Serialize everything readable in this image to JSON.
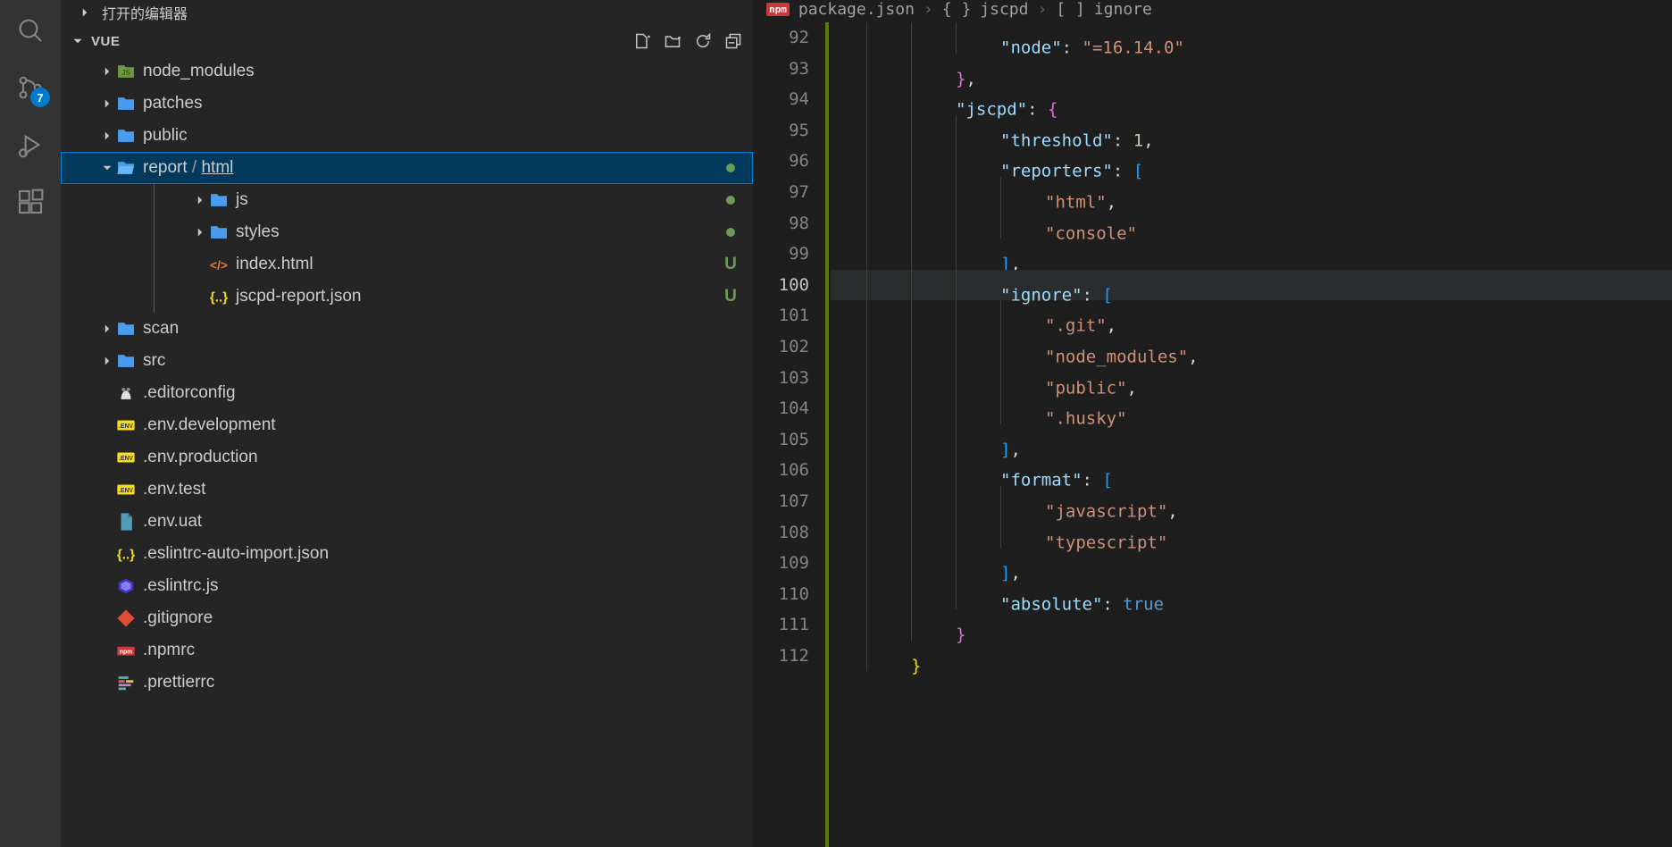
{
  "activity": {
    "badge": "7"
  },
  "sidebar": {
    "openEditors": "打开的编辑器",
    "project": "VUE",
    "tree": [
      {
        "type": "folder",
        "name": "node_modules",
        "depth": 1,
        "expanded": false,
        "icon": "node",
        "dim": true
      },
      {
        "type": "folder",
        "name": "patches",
        "depth": 1,
        "expanded": false,
        "icon": "folder"
      },
      {
        "type": "folder",
        "name": "public",
        "depth": 1,
        "expanded": false,
        "icon": "folder"
      },
      {
        "type": "folder",
        "name": "report",
        "suffix": "html",
        "depth": 1,
        "expanded": true,
        "icon": "folder-open",
        "selected": true,
        "status": "dot"
      },
      {
        "type": "folder",
        "name": "js",
        "depth": 2,
        "expanded": false,
        "icon": "folder",
        "status": "dot",
        "green": true
      },
      {
        "type": "folder",
        "name": "styles",
        "depth": 2,
        "expanded": false,
        "icon": "folder",
        "status": "dot",
        "green": true
      },
      {
        "type": "file",
        "name": "index.html",
        "depth": 2,
        "icon": "html",
        "status": "U",
        "green": true
      },
      {
        "type": "file",
        "name": "jscpd-report.json",
        "depth": 2,
        "icon": "json",
        "status": "U",
        "green": true
      },
      {
        "type": "folder",
        "name": "scan",
        "depth": 1,
        "expanded": false,
        "icon": "folder"
      },
      {
        "type": "folder",
        "name": "src",
        "depth": 1,
        "expanded": false,
        "icon": "folder"
      },
      {
        "type": "file",
        "name": ".editorconfig",
        "depth": 1,
        "icon": "editorconfig"
      },
      {
        "type": "file",
        "name": ".env.development",
        "depth": 1,
        "icon": "env"
      },
      {
        "type": "file",
        "name": ".env.production",
        "depth": 1,
        "icon": "env"
      },
      {
        "type": "file",
        "name": ".env.test",
        "depth": 1,
        "icon": "env"
      },
      {
        "type": "file",
        "name": ".env.uat",
        "depth": 1,
        "icon": "file"
      },
      {
        "type": "file",
        "name": ".eslintrc-auto-import.json",
        "depth": 1,
        "icon": "json"
      },
      {
        "type": "file",
        "name": ".eslintrc.js",
        "depth": 1,
        "icon": "eslint"
      },
      {
        "type": "file",
        "name": ".gitignore",
        "depth": 1,
        "icon": "git"
      },
      {
        "type": "file",
        "name": ".npmrc",
        "depth": 1,
        "icon": "npm"
      },
      {
        "type": "file",
        "name": ".prettierrc",
        "depth": 1,
        "icon": "prettier"
      }
    ]
  },
  "editor": {
    "breadcrumb": [
      "package.json",
      "jscpd",
      "ignore"
    ],
    "startLine": 92,
    "activeLine": 100,
    "lines": [
      [
        {
          "t": "ind",
          "v": "            "
        },
        {
          "t": "key",
          "v": "\"node\""
        },
        {
          "t": "punct",
          "v": ": "
        },
        {
          "t": "str",
          "v": "\"=16.14.0\""
        }
      ],
      [
        {
          "t": "ind",
          "v": "        "
        },
        {
          "t": "brace-p",
          "v": "}"
        },
        {
          "t": "punct",
          "v": ","
        }
      ],
      [
        {
          "t": "ind",
          "v": "        "
        },
        {
          "t": "key",
          "v": "\"jscpd\""
        },
        {
          "t": "punct",
          "v": ": "
        },
        {
          "t": "brace-p",
          "v": "{"
        }
      ],
      [
        {
          "t": "ind",
          "v": "            "
        },
        {
          "t": "key",
          "v": "\"threshold\""
        },
        {
          "t": "punct",
          "v": ": "
        },
        {
          "t": "num",
          "v": "1"
        },
        {
          "t": "punct",
          "v": ","
        }
      ],
      [
        {
          "t": "ind",
          "v": "            "
        },
        {
          "t": "key",
          "v": "\"reporters\""
        },
        {
          "t": "punct",
          "v": ": "
        },
        {
          "t": "brace-b",
          "v": "["
        }
      ],
      [
        {
          "t": "ind",
          "v": "                "
        },
        {
          "t": "str",
          "v": "\"html\""
        },
        {
          "t": "punct",
          "v": ","
        }
      ],
      [
        {
          "t": "ind",
          "v": "                "
        },
        {
          "t": "str",
          "v": "\"console\""
        }
      ],
      [
        {
          "t": "ind",
          "v": "            "
        },
        {
          "t": "brace-b",
          "v": "]"
        },
        {
          "t": "punct",
          "v": ","
        }
      ],
      [
        {
          "t": "ind",
          "v": "            "
        },
        {
          "t": "key",
          "v": "\"ignore\""
        },
        {
          "t": "punct",
          "v": ": "
        },
        {
          "t": "brace-b",
          "v": "["
        }
      ],
      [
        {
          "t": "ind",
          "v": "                "
        },
        {
          "t": "str",
          "v": "\".git\""
        },
        {
          "t": "punct",
          "v": ","
        }
      ],
      [
        {
          "t": "ind",
          "v": "                "
        },
        {
          "t": "str",
          "v": "\"node_modules\""
        },
        {
          "t": "punct",
          "v": ","
        }
      ],
      [
        {
          "t": "ind",
          "v": "                "
        },
        {
          "t": "str",
          "v": "\"public\""
        },
        {
          "t": "punct",
          "v": ","
        }
      ],
      [
        {
          "t": "ind",
          "v": "                "
        },
        {
          "t": "str",
          "v": "\".husky\""
        }
      ],
      [
        {
          "t": "ind",
          "v": "            "
        },
        {
          "t": "brace-b",
          "v": "]"
        },
        {
          "t": "punct",
          "v": ","
        }
      ],
      [
        {
          "t": "ind",
          "v": "            "
        },
        {
          "t": "key",
          "v": "\"format\""
        },
        {
          "t": "punct",
          "v": ": "
        },
        {
          "t": "brace-b",
          "v": "["
        }
      ],
      [
        {
          "t": "ind",
          "v": "                "
        },
        {
          "t": "str",
          "v": "\"javascript\""
        },
        {
          "t": "punct",
          "v": ","
        }
      ],
      [
        {
          "t": "ind",
          "v": "                "
        },
        {
          "t": "str",
          "v": "\"typescript\""
        }
      ],
      [
        {
          "t": "ind",
          "v": "            "
        },
        {
          "t": "brace-b",
          "v": "]"
        },
        {
          "t": "punct",
          "v": ","
        }
      ],
      [
        {
          "t": "ind",
          "v": "            "
        },
        {
          "t": "key",
          "v": "\"absolute\""
        },
        {
          "t": "punct",
          "v": ": "
        },
        {
          "t": "bool",
          "v": "true"
        }
      ],
      [
        {
          "t": "ind",
          "v": "        "
        },
        {
          "t": "brace-p",
          "v": "}"
        }
      ],
      [
        {
          "t": "ind",
          "v": "    "
        },
        {
          "t": "brace-y",
          "v": "}"
        }
      ]
    ]
  }
}
